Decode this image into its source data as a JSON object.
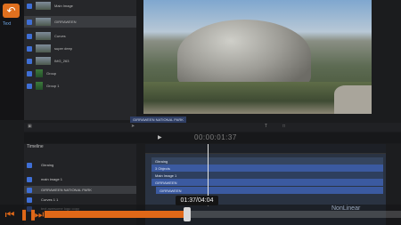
{
  "app": {
    "text_label": "Text"
  },
  "layers": [
    {
      "name": "Main Image",
      "type": "image",
      "selected": false
    },
    {
      "name": "GIRRAWEEN",
      "type": "image",
      "selected": true
    },
    {
      "name": "Curves",
      "type": "image",
      "selected": false
    },
    {
      "name": "super deep",
      "type": "image",
      "selected": false
    },
    {
      "name": "IMG_263",
      "type": "image",
      "selected": false
    },
    {
      "name": "Group",
      "type": "group",
      "selected": false
    },
    {
      "name": "Group 1",
      "type": "group",
      "selected": false
    }
  ],
  "viewer": {
    "title_overlay": "GIRRAWEEN NATIONAL PARK"
  },
  "toolbar": {
    "timecode": "00:00:01:37"
  },
  "timeline": {
    "title": "Timeline",
    "rows": [
      {
        "label": "Girraing",
        "selected": false
      },
      {
        "label": "main image 1",
        "selected": false
      },
      {
        "label": "GIRRAWEEN NATIONAL PARK",
        "selected": true
      },
      {
        "label": "Curves 1 1",
        "selected": false
      },
      {
        "label": "text awesome logo copy",
        "selected": false
      }
    ],
    "bars": [
      {
        "label": "Girraing"
      },
      {
        "label": "3 Objects"
      },
      {
        "label": "Main Image 1"
      },
      {
        "label": "GIRRAWEEN"
      },
      {
        "label": "GIRRAWEEN"
      }
    ]
  },
  "player": {
    "time_display": "01:37/04:04",
    "progress_fraction": 0.4,
    "brand": "NonLinear",
    "accent": "#e06818"
  }
}
